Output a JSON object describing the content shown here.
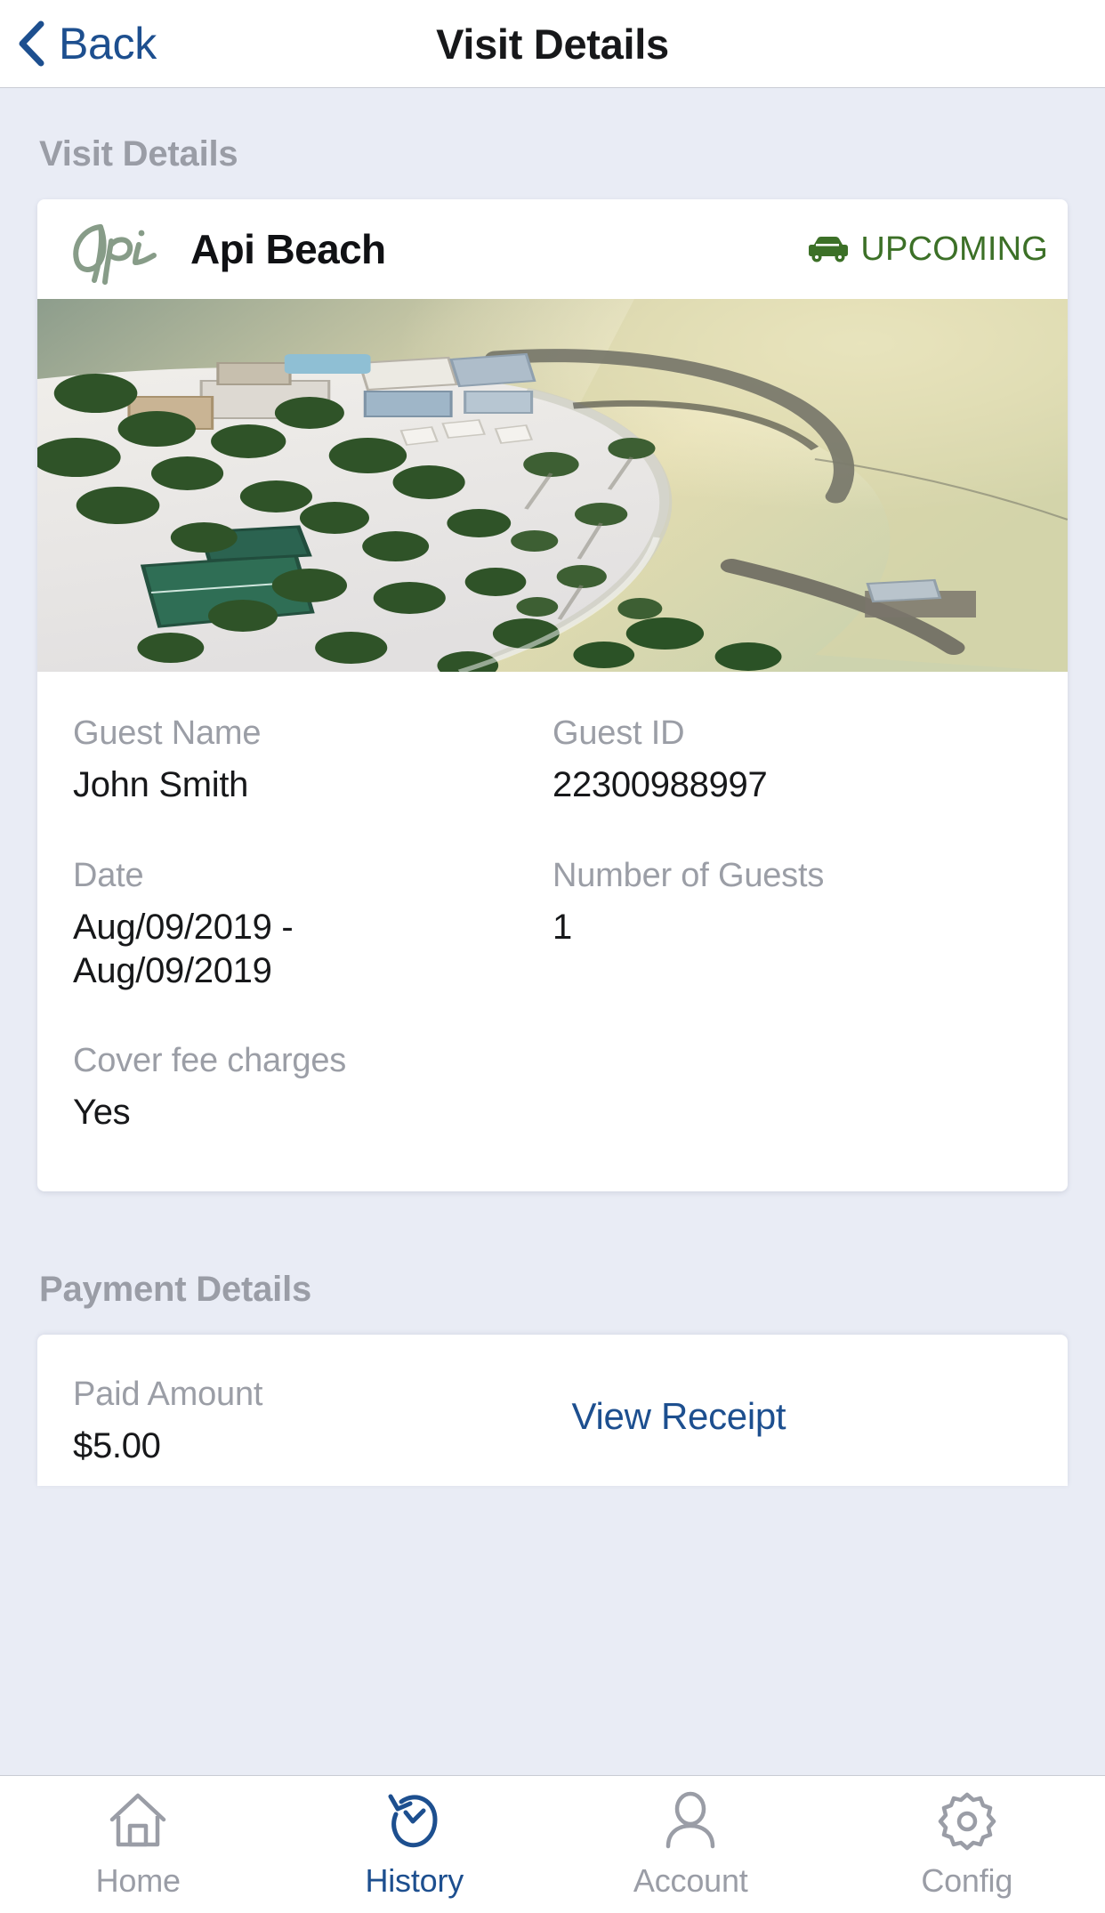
{
  "navbar": {
    "back_label": "Back",
    "title": "Visit Details"
  },
  "visit_section": {
    "heading": "Visit Details",
    "venue": {
      "logo_text": "Api",
      "name": "Api Beach",
      "status_label": "UPCOMING",
      "status_color": "#3c7027"
    },
    "fields": [
      {
        "label": "Guest Name",
        "value": "John Smith"
      },
      {
        "label": "Guest ID",
        "value": "22300988997"
      },
      {
        "label": "Date",
        "value": "Aug/09/2019 - Aug/09/2019"
      },
      {
        "label": "Number of Guests",
        "value": "1"
      },
      {
        "label": "Cover fee charges",
        "value": "Yes"
      }
    ]
  },
  "payment_section": {
    "heading": "Payment Details",
    "paid_amount_label": "Paid Amount",
    "paid_amount_value": "$5.00",
    "view_receipt_label": "View Receipt"
  },
  "tabbar": {
    "items": [
      {
        "label": "Home",
        "icon": "home-icon",
        "active": false
      },
      {
        "label": "History",
        "icon": "history-clock-icon",
        "active": true
      },
      {
        "label": "Account",
        "icon": "person-icon",
        "active": false
      },
      {
        "label": "Config",
        "icon": "gear-icon",
        "active": false
      }
    ],
    "active_color": "#1d4f8f",
    "inactive_color": "#9a9da6"
  }
}
